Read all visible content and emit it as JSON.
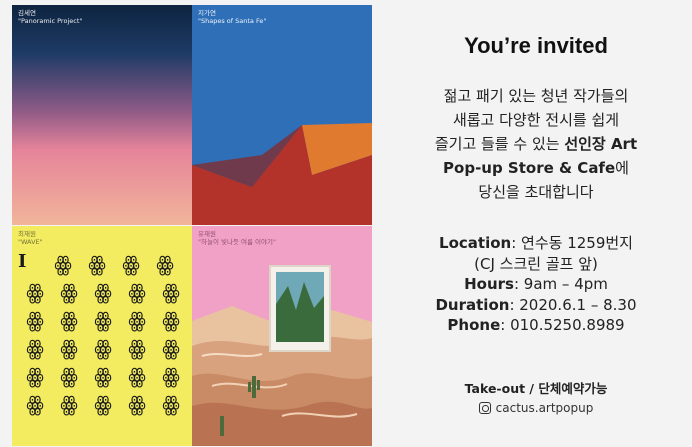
{
  "collage": {
    "tiles": [
      {
        "caption": "김세연\n\"Panoramic Project\""
      },
      {
        "caption": "지가연\n\"Shapes of Santa Fe\""
      },
      {
        "caption": "최재원\n\"WAVE\""
      },
      {
        "caption": "유재원\n\"하늘이 빛나듯 여름 이야기\""
      }
    ],
    "pattern_letter": "I",
    "pattern_glyph": "ꙮ"
  },
  "invite": {
    "title": "You’re invited",
    "intro_l1": "젊고 패기 있는 청년 작가들의",
    "intro_l2": "새롭고 다양한 전시를 쉽게",
    "intro_l3_a": "즐기고 들를 수 있는 ",
    "intro_l3_b": "선인장 Art",
    "intro_l4_a": "Pop-up Store & Cafe",
    "intro_l4_b": "에",
    "intro_l5": "당신을 초대합니다",
    "location_key": "Location",
    "location_val": ": 연수동 1259번지",
    "location_sub": "(CJ 스크린 골프 앞)",
    "hours_key": "Hours",
    "hours_val": ": 9am – 4pm",
    "duration_key": "Duration",
    "duration_val": ": 2020.6.1 – 8.30",
    "phone_key": "Phone",
    "phone_val": ": 010.5250.8989",
    "footer_note": "Take-out / 단체예약가능",
    "instagram": "cactus.artpopup"
  }
}
